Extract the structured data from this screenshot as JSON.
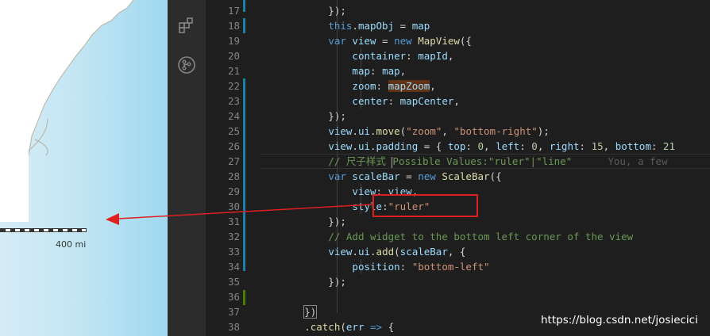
{
  "map": {
    "scale_label": "400 mi",
    "colors": {
      "water_light": "#d5ecf6",
      "water_dark": "#9fd8ef",
      "land": "#ffffff"
    }
  },
  "activity_bar": {
    "icons": [
      "extensions-icon",
      "source-control-icon"
    ]
  },
  "editor": {
    "colors": {
      "background": "#1e1e1e",
      "keyword": "#569cd6",
      "function": "#dcdcaa",
      "string": "#ce9178",
      "comment": "#6a9955",
      "number": "#b5cea8"
    },
    "lines": [
      {
        "number": "17",
        "segments": [
          {
            "t": "            });",
            "c": ""
          }
        ]
      },
      {
        "number": "18",
        "segments": [
          {
            "t": "            ",
            "c": ""
          },
          {
            "t": "this",
            "c": "kw"
          },
          {
            "t": ".",
            "c": ""
          },
          {
            "t": "mapObj",
            "c": "var"
          },
          {
            "t": " = ",
            "c": ""
          },
          {
            "t": "map",
            "c": "var"
          }
        ]
      },
      {
        "number": "19",
        "segments": [
          {
            "t": "            ",
            "c": ""
          },
          {
            "t": "var",
            "c": "kw"
          },
          {
            "t": " ",
            "c": ""
          },
          {
            "t": "view",
            "c": "var"
          },
          {
            "t": " = ",
            "c": ""
          },
          {
            "t": "new",
            "c": "kw"
          },
          {
            "t": " ",
            "c": ""
          },
          {
            "t": "MapView",
            "c": "fn"
          },
          {
            "t": "({",
            "c": ""
          }
        ]
      },
      {
        "number": "20",
        "segments": [
          {
            "t": "                ",
            "c": ""
          },
          {
            "t": "container",
            "c": "var"
          },
          {
            "t": ": ",
            "c": ""
          },
          {
            "t": "mapId",
            "c": "var"
          },
          {
            "t": ",",
            "c": ""
          }
        ]
      },
      {
        "number": "21",
        "segments": [
          {
            "t": "                ",
            "c": ""
          },
          {
            "t": "map",
            "c": "var"
          },
          {
            "t": ": ",
            "c": ""
          },
          {
            "t": "map",
            "c": "var"
          },
          {
            "t": ",",
            "c": ""
          }
        ]
      },
      {
        "number": "22",
        "segments": [
          {
            "t": "                ",
            "c": ""
          },
          {
            "t": "zoom",
            "c": "var"
          },
          {
            "t": ": ",
            "c": ""
          },
          {
            "t": "mapZoom",
            "c": "var hl"
          },
          {
            "t": ",",
            "c": ""
          }
        ]
      },
      {
        "number": "23",
        "segments": [
          {
            "t": "                ",
            "c": ""
          },
          {
            "t": "center",
            "c": "var"
          },
          {
            "t": ": ",
            "c": ""
          },
          {
            "t": "mapCenter",
            "c": "var"
          },
          {
            "t": ",",
            "c": ""
          }
        ]
      },
      {
        "number": "24",
        "segments": [
          {
            "t": "            });",
            "c": ""
          }
        ]
      },
      {
        "number": "25",
        "segments": [
          {
            "t": "            ",
            "c": ""
          },
          {
            "t": "view",
            "c": "var"
          },
          {
            "t": ".",
            "c": ""
          },
          {
            "t": "ui",
            "c": "var"
          },
          {
            "t": ".",
            "c": ""
          },
          {
            "t": "move",
            "c": "fn"
          },
          {
            "t": "(",
            "c": ""
          },
          {
            "t": "\"zoom\"",
            "c": "str"
          },
          {
            "t": ", ",
            "c": ""
          },
          {
            "t": "\"bottom-right\"",
            "c": "str"
          },
          {
            "t": ");",
            "c": ""
          }
        ]
      },
      {
        "number": "26",
        "segments": [
          {
            "t": "            ",
            "c": ""
          },
          {
            "t": "view",
            "c": "var"
          },
          {
            "t": ".",
            "c": ""
          },
          {
            "t": "ui",
            "c": "var"
          },
          {
            "t": ".",
            "c": ""
          },
          {
            "t": "padding",
            "c": "var"
          },
          {
            "t": " = { ",
            "c": ""
          },
          {
            "t": "top",
            "c": "var"
          },
          {
            "t": ": ",
            "c": ""
          },
          {
            "t": "0",
            "c": "num"
          },
          {
            "t": ", ",
            "c": ""
          },
          {
            "t": "left",
            "c": "var"
          },
          {
            "t": ": ",
            "c": ""
          },
          {
            "t": "0",
            "c": "num"
          },
          {
            "t": ", ",
            "c": ""
          },
          {
            "t": "right",
            "c": "var"
          },
          {
            "t": ": ",
            "c": ""
          },
          {
            "t": "15",
            "c": "num"
          },
          {
            "t": ", ",
            "c": ""
          },
          {
            "t": "bottom",
            "c": "var"
          },
          {
            "t": ": ",
            "c": ""
          },
          {
            "t": "21",
            "c": "num"
          }
        ]
      },
      {
        "number": "27",
        "segments": [
          {
            "t": "            ",
            "c": ""
          },
          {
            "t": "// 尺子样式 ",
            "c": "cm"
          },
          {
            "t": "",
            "c": "cursor"
          },
          {
            "t": "Possible Values:\"ruler\"|\"line\"",
            "c": "cm"
          },
          {
            "t": "      You, a few",
            "c": "blame"
          }
        ]
      },
      {
        "number": "28",
        "segments": [
          {
            "t": "            ",
            "c": ""
          },
          {
            "t": "var",
            "c": "kw"
          },
          {
            "t": " ",
            "c": ""
          },
          {
            "t": "scaleBar",
            "c": "var"
          },
          {
            "t": " = ",
            "c": ""
          },
          {
            "t": "new",
            "c": "kw"
          },
          {
            "t": " ",
            "c": ""
          },
          {
            "t": "ScaleBar",
            "c": "fn"
          },
          {
            "t": "({",
            "c": ""
          }
        ]
      },
      {
        "number": "29",
        "segments": [
          {
            "t": "                ",
            "c": ""
          },
          {
            "t": "view",
            "c": "var"
          },
          {
            "t": ": ",
            "c": ""
          },
          {
            "t": "view",
            "c": "var"
          },
          {
            "t": ",",
            "c": ""
          }
        ]
      },
      {
        "number": "30",
        "segments": [
          {
            "t": "                ",
            "c": ""
          },
          {
            "t": "style",
            "c": "var"
          },
          {
            "t": ":",
            "c": ""
          },
          {
            "t": "\"ruler\"",
            "c": "str"
          }
        ]
      },
      {
        "number": "31",
        "segments": [
          {
            "t": "            });",
            "c": ""
          }
        ]
      },
      {
        "number": "32",
        "segments": [
          {
            "t": "            ",
            "c": ""
          },
          {
            "t": "// Add widget to the bottom left corner of the view",
            "c": "cm"
          }
        ]
      },
      {
        "number": "33",
        "segments": [
          {
            "t": "            ",
            "c": ""
          },
          {
            "t": "view",
            "c": "var"
          },
          {
            "t": ".",
            "c": ""
          },
          {
            "t": "ui",
            "c": "var"
          },
          {
            "t": ".",
            "c": ""
          },
          {
            "t": "add",
            "c": "fn"
          },
          {
            "t": "(",
            "c": ""
          },
          {
            "t": "scaleBar",
            "c": "var"
          },
          {
            "t": ", {",
            "c": ""
          }
        ]
      },
      {
        "number": "34",
        "segments": [
          {
            "t": "                ",
            "c": ""
          },
          {
            "t": "position",
            "c": "var"
          },
          {
            "t": ": ",
            "c": ""
          },
          {
            "t": "\"bottom-left\"",
            "c": "str"
          }
        ]
      },
      {
        "number": "35",
        "segments": [
          {
            "t": "            });",
            "c": ""
          }
        ]
      },
      {
        "number": "36",
        "segments": [
          {
            "t": "",
            "c": ""
          }
        ]
      },
      {
        "number": "37",
        "segments": [
          {
            "t": "        ",
            "c": ""
          },
          {
            "t": "})",
            "c": "bracket-hl"
          }
        ]
      },
      {
        "number": "38",
        "segments": [
          {
            "t": "        .",
            "c": ""
          },
          {
            "t": "catch",
            "c": "fn"
          },
          {
            "t": "(",
            "c": ""
          },
          {
            "t": "err",
            "c": "var"
          },
          {
            "t": " ",
            "c": ""
          },
          {
            "t": "=>",
            "c": "kw"
          },
          {
            "t": " {",
            "c": ""
          }
        ]
      }
    ]
  },
  "annotation": {
    "color": "#e02020"
  },
  "watermark": "https://blog.csdn.net/josiecici"
}
